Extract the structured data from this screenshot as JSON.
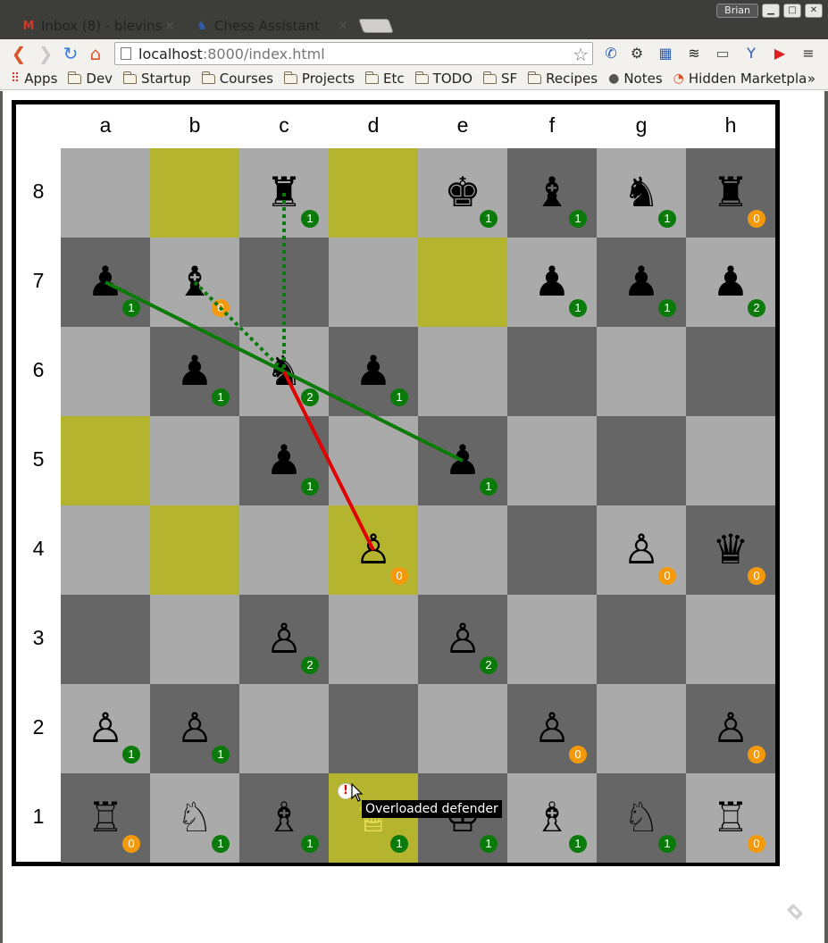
{
  "browser": {
    "tabs": [
      {
        "title": "Inbox (8) - blevinstei",
        "icon": "gmail-icon",
        "close": "×",
        "active": false
      },
      {
        "title": "Chess Assistant",
        "icon": "chess-favicon",
        "close": "×",
        "active": true
      }
    ],
    "user_label": "Brian",
    "url_host": "localhost",
    "url_path": ":8000/index.html",
    "bookmarks": [
      {
        "label": "Apps",
        "icon": "apps-grid-icon"
      },
      {
        "label": "Dev",
        "icon": "folder-icon"
      },
      {
        "label": "Startup",
        "icon": "folder-icon"
      },
      {
        "label": "Courses",
        "icon": "folder-icon"
      },
      {
        "label": "Projects",
        "icon": "folder-icon"
      },
      {
        "label": "Etc",
        "icon": "folder-icon"
      },
      {
        "label": "TODO",
        "icon": "folder-icon"
      },
      {
        "label": "SF",
        "icon": "folder-icon"
      },
      {
        "label": "Recipes",
        "icon": "folder-icon"
      },
      {
        "label": "Notes",
        "icon": "apple-icon"
      },
      {
        "label": "Hidden Marketpla",
        "icon": "clock-icon"
      }
    ],
    "bookmarks_more": "»"
  },
  "board": {
    "files": [
      "a",
      "b",
      "c",
      "d",
      "e",
      "f",
      "g",
      "h"
    ],
    "ranks": [
      "8",
      "7",
      "6",
      "5",
      "4",
      "3",
      "2",
      "1"
    ],
    "colors": {
      "dark": "#666666",
      "light": "#aaaaaa",
      "highlight": "#b5b42f",
      "badge_green": "#0a7a0a",
      "badge_orange": "#f39a0c",
      "arrow_green": "#0a7a0a",
      "arrow_red": "#e00000"
    },
    "highlighted_squares": [
      "b8",
      "d8",
      "e7",
      "a5",
      "b4",
      "d4",
      "d1"
    ],
    "pieces": [
      {
        "square": "c8",
        "glyph": "♜",
        "name": "black-rook",
        "count": "1",
        "badge": "green"
      },
      {
        "square": "e8",
        "glyph": "♚",
        "name": "black-king",
        "count": "1",
        "badge": "green"
      },
      {
        "square": "f8",
        "glyph": "♝",
        "name": "black-bishop",
        "count": "1",
        "badge": "green"
      },
      {
        "square": "g8",
        "glyph": "♞",
        "name": "black-knight",
        "count": "1",
        "badge": "green"
      },
      {
        "square": "h8",
        "glyph": "♜",
        "name": "black-rook",
        "count": "0",
        "badge": "orange"
      },
      {
        "square": "a7",
        "glyph": "♟",
        "name": "black-pawn",
        "count": "1",
        "badge": "green"
      },
      {
        "square": "b7",
        "glyph": "♝",
        "name": "black-bishop",
        "count": "0",
        "badge": "orange"
      },
      {
        "square": "f7",
        "glyph": "♟",
        "name": "black-pawn",
        "count": "1",
        "badge": "green"
      },
      {
        "square": "g7",
        "glyph": "♟",
        "name": "black-pawn",
        "count": "1",
        "badge": "green"
      },
      {
        "square": "h7",
        "glyph": "♟",
        "name": "black-pawn",
        "count": "2",
        "badge": "green"
      },
      {
        "square": "b6",
        "glyph": "♟",
        "name": "black-pawn",
        "count": "1",
        "badge": "green"
      },
      {
        "square": "c6",
        "glyph": "♞",
        "name": "black-knight",
        "count": "2",
        "badge": "green"
      },
      {
        "square": "d6",
        "glyph": "♟",
        "name": "black-pawn",
        "count": "1",
        "badge": "green"
      },
      {
        "square": "c5",
        "glyph": "♟",
        "name": "black-pawn",
        "count": "1",
        "badge": "green"
      },
      {
        "square": "e5",
        "glyph": "♟",
        "name": "black-pawn",
        "count": "1",
        "badge": "green"
      },
      {
        "square": "d4",
        "glyph": "♙",
        "name": "white-pawn",
        "count": "0",
        "badge": "orange"
      },
      {
        "square": "g4",
        "glyph": "♙",
        "name": "white-pawn",
        "count": "0",
        "badge": "orange"
      },
      {
        "square": "h4",
        "glyph": "♛",
        "name": "black-queen",
        "count": "0",
        "badge": "orange"
      },
      {
        "square": "c3",
        "glyph": "♙",
        "name": "white-pawn",
        "count": "2",
        "badge": "green"
      },
      {
        "square": "e3",
        "glyph": "♙",
        "name": "white-pawn",
        "count": "2",
        "badge": "green"
      },
      {
        "square": "a2",
        "glyph": "♙",
        "name": "white-pawn",
        "count": "1",
        "badge": "green"
      },
      {
        "square": "b2",
        "glyph": "♙",
        "name": "white-pawn",
        "count": "1",
        "badge": "green"
      },
      {
        "square": "f2",
        "glyph": "♙",
        "name": "white-pawn",
        "count": "0",
        "badge": "orange"
      },
      {
        "square": "h2",
        "glyph": "♙",
        "name": "white-pawn",
        "count": "0",
        "badge": "orange"
      },
      {
        "square": "a1",
        "glyph": "♖",
        "name": "white-rook",
        "count": "0",
        "badge": "orange"
      },
      {
        "square": "b1",
        "glyph": "♘",
        "name": "white-knight",
        "count": "1",
        "badge": "green"
      },
      {
        "square": "c1",
        "glyph": "♗",
        "name": "white-bishop",
        "count": "1",
        "badge": "green"
      },
      {
        "square": "d1",
        "glyph": "♕",
        "name": "white-queen",
        "count": "1",
        "badge": "green",
        "highlight_piece": true
      },
      {
        "square": "e1",
        "glyph": "♔",
        "name": "white-king",
        "count": "1",
        "badge": "green"
      },
      {
        "square": "f1",
        "glyph": "♗",
        "name": "white-bishop",
        "count": "1",
        "badge": "green"
      },
      {
        "square": "g1",
        "glyph": "♘",
        "name": "white-knight",
        "count": "1",
        "badge": "green"
      },
      {
        "square": "h1",
        "glyph": "♖",
        "name": "white-rook",
        "count": "0",
        "badge": "orange"
      }
    ],
    "arrows": [
      {
        "from": "a7",
        "to": "e5",
        "color": "green",
        "style": "solid"
      },
      {
        "from": "b7",
        "to": "c6",
        "color": "green",
        "style": "dotted"
      },
      {
        "from": "c8",
        "to": "c6",
        "color": "green",
        "style": "dotted"
      },
      {
        "from": "c6",
        "to": "d4",
        "color": "red",
        "style": "solid"
      }
    ]
  },
  "tooltip": {
    "text": "Overloaded defender",
    "warning_glyph": "!"
  }
}
